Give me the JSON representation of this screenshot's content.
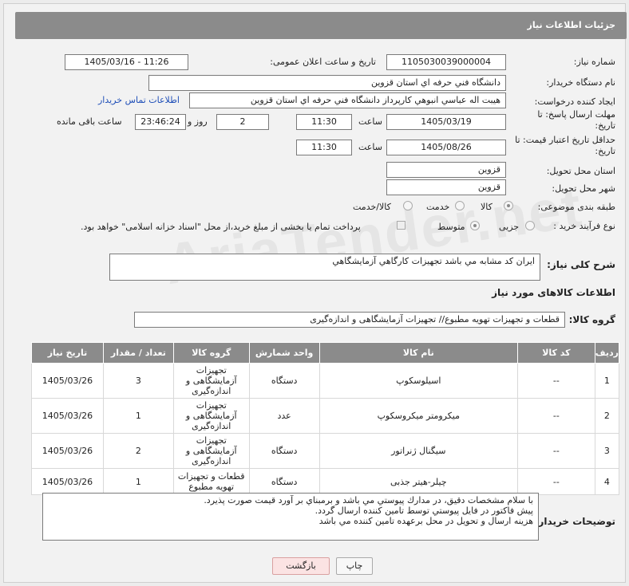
{
  "header": {
    "title": "جزئیات اطلاعات نیاز"
  },
  "form": {
    "need_number": {
      "label": "شماره نیاز:",
      "value": "1105030039000004"
    },
    "announce": {
      "label": "تاریخ و ساعت اعلان عمومی:",
      "value": "1405/03/16 - 11:26"
    },
    "buyer_org": {
      "label": "نام دستگاه خریدار:",
      "value": "دانشگاه فني حرفه اي استان قزوين"
    },
    "requester": {
      "label": "ایجاد کننده درخواست:",
      "value": "هيبت اله عباسي انبوهي كارپرداز دانشگاه فني حرفه اي استان قزوين",
      "contact_link": "اطلاعات تماس خریدار"
    },
    "deadline": {
      "label": "مهلت ارسال پاسخ: تا تاریخ:",
      "date": "1405/03/19",
      "time_label": "ساعت",
      "time": "11:30",
      "days": "2",
      "days_label": "روز و",
      "remaining": "23:46:24",
      "remaining_label": "ساعت باقی مانده"
    },
    "price_validity": {
      "label": "حداقل تاریخ اعتبار قیمت: تا تاریخ:",
      "date": "1405/08/26",
      "time_label": "ساعت",
      "time": "11:30"
    },
    "province": {
      "label": "استان محل تحویل:",
      "value": "قزوين"
    },
    "city": {
      "label": "شهر محل تحویل:",
      "value": "قزوين"
    },
    "category": {
      "label": "طبقه بندی موضوعی:",
      "options": [
        "کالا",
        "خدمت",
        "کالا/خدمت"
      ],
      "selected": "کالا"
    },
    "purchase_type": {
      "label": "نوع فرآیند خرید :",
      "options": [
        "جزیی",
        "متوسط"
      ],
      "selected": "متوسط",
      "note": "پرداخت تمام یا بخشی از مبلغ خرید،از محل \"اسناد خزانه اسلامی\" خواهد بود."
    },
    "summary": {
      "label": "شرح کلی نیاز:",
      "value": "ايران كد مشابه مي باشد تجهيزات كارگاهي آزمايشگاهي"
    }
  },
  "goods": {
    "section_title": "اطلاعات کالاهای مورد نیاز",
    "group_label": "گروه کالا:",
    "group_value": "قطعات و تجهیزات تهویه مطبوع// تجهیزات آزمایشگاهی و اندازه‌گیری",
    "columns": [
      "ردیف",
      "کد کالا",
      "نام کالا",
      "واحد شمارش",
      "گروه کالا",
      "تعداد / مقدار",
      "تاریخ نیاز"
    ],
    "rows": [
      {
        "idx": "1",
        "code": "--",
        "name": "اسیلوسکوپ",
        "unit": "دستگاه",
        "group": "تجهیزات آزمایشگاهی و اندازه‌گیری",
        "qty": "3",
        "date": "1405/03/26"
      },
      {
        "idx": "2",
        "code": "--",
        "name": "میکرومتر میکروسکوپ",
        "unit": "عدد",
        "group": "تجهیزات آزمایشگاهی و اندازه‌گیری",
        "qty": "1",
        "date": "1405/03/26"
      },
      {
        "idx": "3",
        "code": "--",
        "name": "سیگنال ژنراتور",
        "unit": "دستگاه",
        "group": "تجهیزات آزمایشگاهی و اندازه‌گیری",
        "qty": "2",
        "date": "1405/03/26"
      },
      {
        "idx": "4",
        "code": "--",
        "name": "چیلر-هیتر جذبی",
        "unit": "دستگاه",
        "group": "قطعات و تجهیزات تهویه مطبوع",
        "qty": "1",
        "date": "1405/03/26"
      }
    ]
  },
  "buyer_notes": {
    "label": "توضیحات خریدار:",
    "lines": [
      "با سلام مشخصات دقيق، در مدارك پيوستي مي باشد و برمبناي بر آورد قيمت صورت پذيرد.",
      "پيش فاكتور در فايل پيوستي توسط تامين كننده ارسال گردد.",
      "هزينه ارسال و تحويل در محل برعهده تامين كننده مي باشد"
    ]
  },
  "buttons": {
    "print": "چاپ",
    "back": "بازگشت"
  },
  "watermark": "AriaTender.net"
}
